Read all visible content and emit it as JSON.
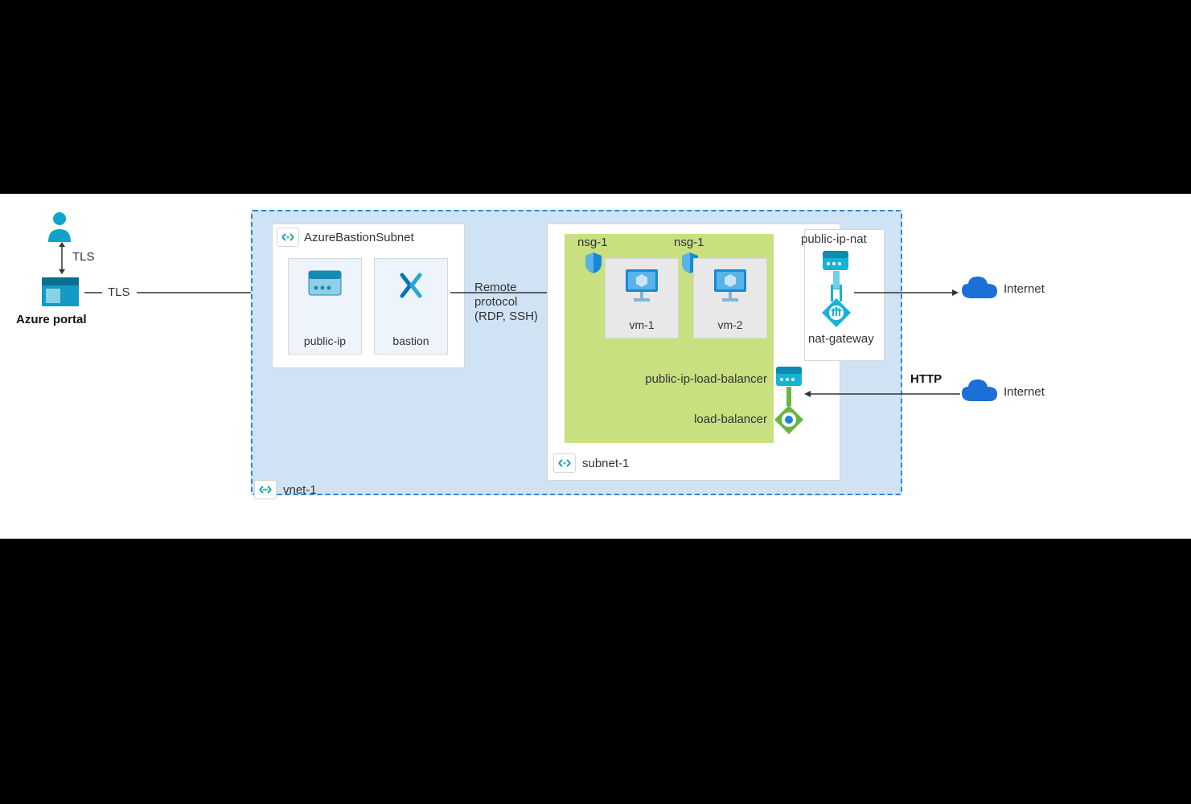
{
  "diagram": {
    "user_label": "Azure portal",
    "tls1": "TLS",
    "tls2": "TLS",
    "vnet": {
      "name": "vnet-1",
      "subnet_bastion": "AzureBastionSubnet",
      "subnet1": "subnet-1"
    },
    "bastion_card": {
      "public_ip": "public-ip",
      "bastion": "bastion"
    },
    "remote_proto_line1": "Remote",
    "remote_proto_line2": "protocol",
    "remote_proto_line3": "(RDP, SSH)",
    "nsg1a": "nsg-1",
    "nsg1b": "nsg-1",
    "vm1": "vm-1",
    "vm2": "vm-2",
    "public_ip_nat": "public-ip-nat",
    "nat_gateway": "nat-gateway",
    "public_ip_lb": "public-ip-load-balancer",
    "load_balancer": "load-balancer",
    "http": "HTTP",
    "internet1": "Internet",
    "internet2": "Internet"
  }
}
